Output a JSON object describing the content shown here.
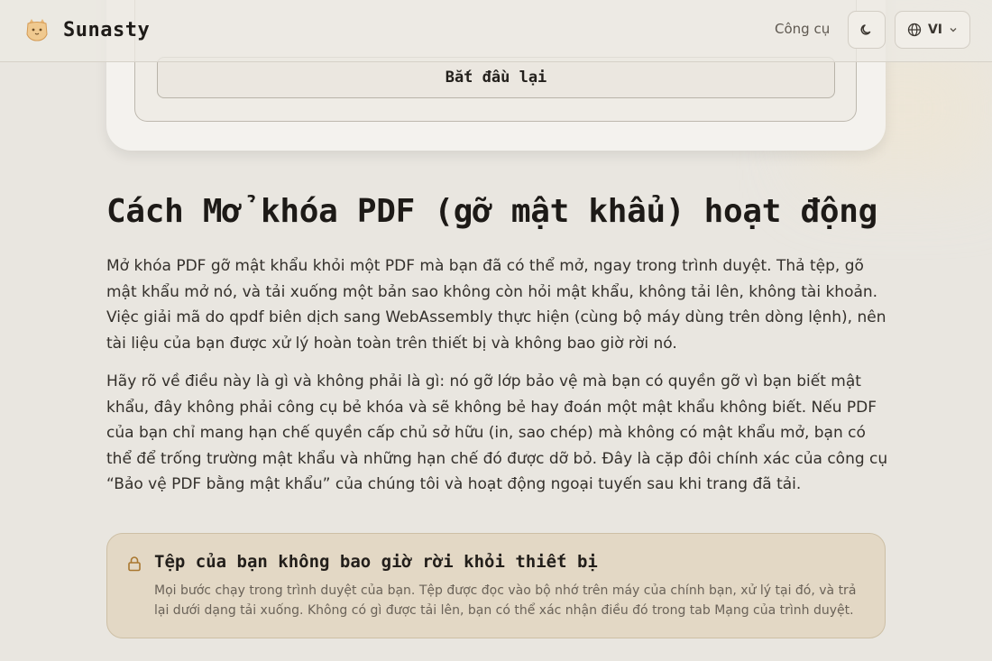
{
  "header": {
    "brand_name": "Sunasty",
    "nav_tools": "Công cụ",
    "lang_code": "VI",
    "icons": {
      "logo": "cat-logo-icon",
      "theme": "moon-icon",
      "lang": "globe-icon",
      "caret": "chevron-down-icon"
    }
  },
  "tool": {
    "restart_label": "Bắt đầu lại"
  },
  "article": {
    "title": "Cách Mở khóa PDF (gỡ mật khẩu) hoạt động",
    "paragraph_1": "Mở khóa PDF gỡ mật khẩu khỏi một PDF mà bạn đã có thể mở, ngay trong trình duyệt. Thả tệp, gõ mật khẩu mở nó, và tải xuống một bản sao không còn hỏi mật khẩu, không tải lên, không tài khoản. Việc giải mã do qpdf biên dịch sang WebAssembly thực hiện (cùng bộ máy dùng trên dòng lệnh), nên tài liệu của bạn được xử lý hoàn toàn trên thiết bị và không bao giờ rời nó.",
    "paragraph_2": "Hãy rõ về điều này là gì và không phải là gì: nó gỡ lớp bảo vệ mà bạn có quyền gỡ vì bạn biết mật khẩu, đây không phải công cụ bẻ khóa và sẽ không bẻ hay đoán một mật khẩu không biết. Nếu PDF của bạn chỉ mang hạn chế quyền cấp chủ sở hữu (in, sao chép) mà không có mật khẩu mở, bạn có thể để trống trường mật khẩu và những hạn chế đó được dỡ bỏ. Đây là cặp đôi chính xác của công cụ “Bảo vệ PDF bằng mật khẩu” của chúng tôi và hoạt động ngoại tuyến sau khi trang đã tải."
  },
  "notice": {
    "icon": "lock-icon",
    "title": "Tệp của bạn không bao giờ rời khỏi thiết bị",
    "body": "Mọi bước chạy trong trình duyệt của bạn. Tệp được đọc vào bộ nhớ trên máy của chính bạn, xử lý tại đó, và trả lại dưới dạng tải xuống. Không có gì được tải lên, bạn có thể xác nhận điều đó trong tab Mạng của trình duyệt."
  },
  "colors": {
    "background": "#e9e6e0",
    "notice_bg": "#e3d8c5",
    "accent": "#a9772f"
  }
}
